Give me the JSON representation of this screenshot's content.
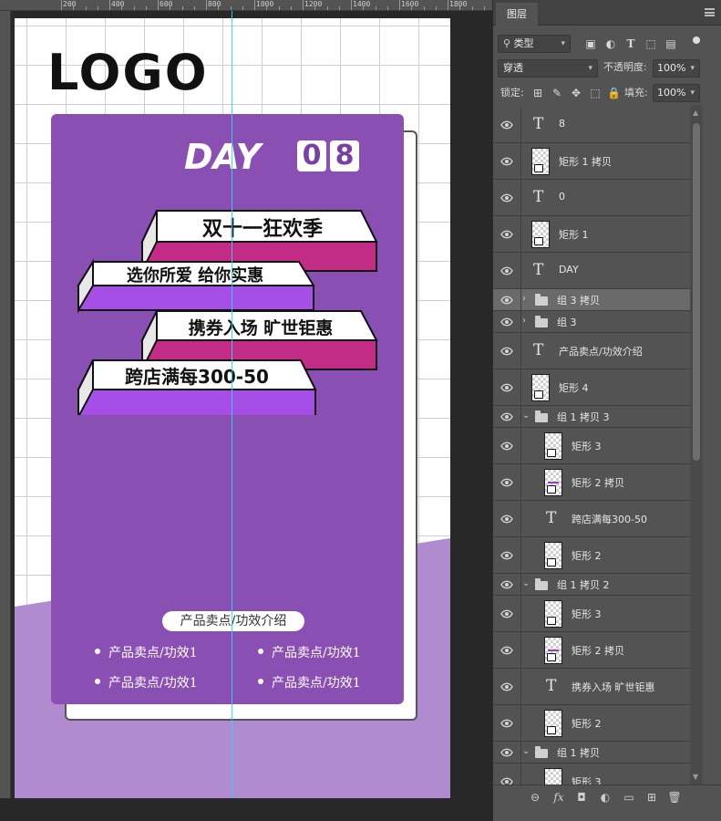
{
  "ruler": {
    "labels": [
      "200",
      "400",
      "600",
      "800",
      "1000",
      "1200",
      "1400",
      "1600",
      "1800"
    ]
  },
  "artboard": {
    "logo": "LOGO",
    "day_label": "DAY",
    "day_digits": [
      "0",
      "8"
    ],
    "banner_lines": [
      "双十一狂欢季",
      "选你所爱 给你实惠",
      "携券入场 旷世钜惠",
      "跨店满每300-50"
    ],
    "product_tag": "产品卖点/功效介绍",
    "product_items": [
      "产品卖点/功效1",
      "产品卖点/功效1",
      "产品卖点/功效1",
      "产品卖点/功效1"
    ],
    "colors": {
      "card": "#8a4fb2",
      "bottom_band": "#b08bd0",
      "bar_white": "#ffffff",
      "bar_magenta": "#c22c86",
      "bar_violet": "#a64fe6",
      "guide": "#27d8ff"
    }
  },
  "panel": {
    "tab": "图层",
    "filter_label": "类型",
    "blend_mode": "穿透",
    "opacity_label": "不透明度:",
    "opacity_value": "100%",
    "lock_label": "锁定:",
    "fill_label": "填充:",
    "fill_value": "100%",
    "layers": [
      {
        "kind": "text",
        "name": "8",
        "indent": 0
      },
      {
        "kind": "shape",
        "name": "矩形 1 拷贝",
        "indent": 0
      },
      {
        "kind": "text",
        "name": "0",
        "indent": 0
      },
      {
        "kind": "shape",
        "name": "矩形 1",
        "indent": 0
      },
      {
        "kind": "text",
        "name": "DAY",
        "indent": 0
      },
      {
        "kind": "group",
        "name": "组 3 拷贝",
        "indent": 0,
        "expanded": false,
        "selected": true
      },
      {
        "kind": "group",
        "name": "组 3",
        "indent": 0,
        "expanded": false
      },
      {
        "kind": "text",
        "name": "产品卖点/功效介绍",
        "indent": 0
      },
      {
        "kind": "shape",
        "name": "矩形 4",
        "indent": 0
      },
      {
        "kind": "group",
        "name": "组 1 拷贝 3",
        "indent": 0,
        "expanded": true
      },
      {
        "kind": "shape",
        "name": "矩形 3",
        "indent": 1
      },
      {
        "kind": "shape-line",
        "name": "矩形 2 拷贝",
        "indent": 1
      },
      {
        "kind": "text",
        "name": "跨店满每300-50",
        "indent": 1
      },
      {
        "kind": "shape",
        "name": "矩形 2",
        "indent": 1
      },
      {
        "kind": "group",
        "name": "组 1 拷贝 2",
        "indent": 0,
        "expanded": true
      },
      {
        "kind": "shape",
        "name": "矩形 3",
        "indent": 1
      },
      {
        "kind": "shape-line",
        "name": "矩形 2 拷贝",
        "indent": 1
      },
      {
        "kind": "text",
        "name": "携券入场 旷世钜惠",
        "indent": 1
      },
      {
        "kind": "shape",
        "name": "矩形 2",
        "indent": 1
      },
      {
        "kind": "group",
        "name": "组 1 拷贝",
        "indent": 0,
        "expanded": true
      },
      {
        "kind": "shape",
        "name": "矩形 3",
        "indent": 1
      }
    ],
    "footer_icons": [
      "link-icon",
      "fx-icon",
      "mask-icon",
      "adjustment-icon",
      "folder-icon",
      "new-layer-icon",
      "trash-icon"
    ],
    "footer_glyphs": [
      "⊖",
      "fx",
      "◘",
      "◐",
      "▭",
      "⊞",
      "🗑"
    ]
  }
}
